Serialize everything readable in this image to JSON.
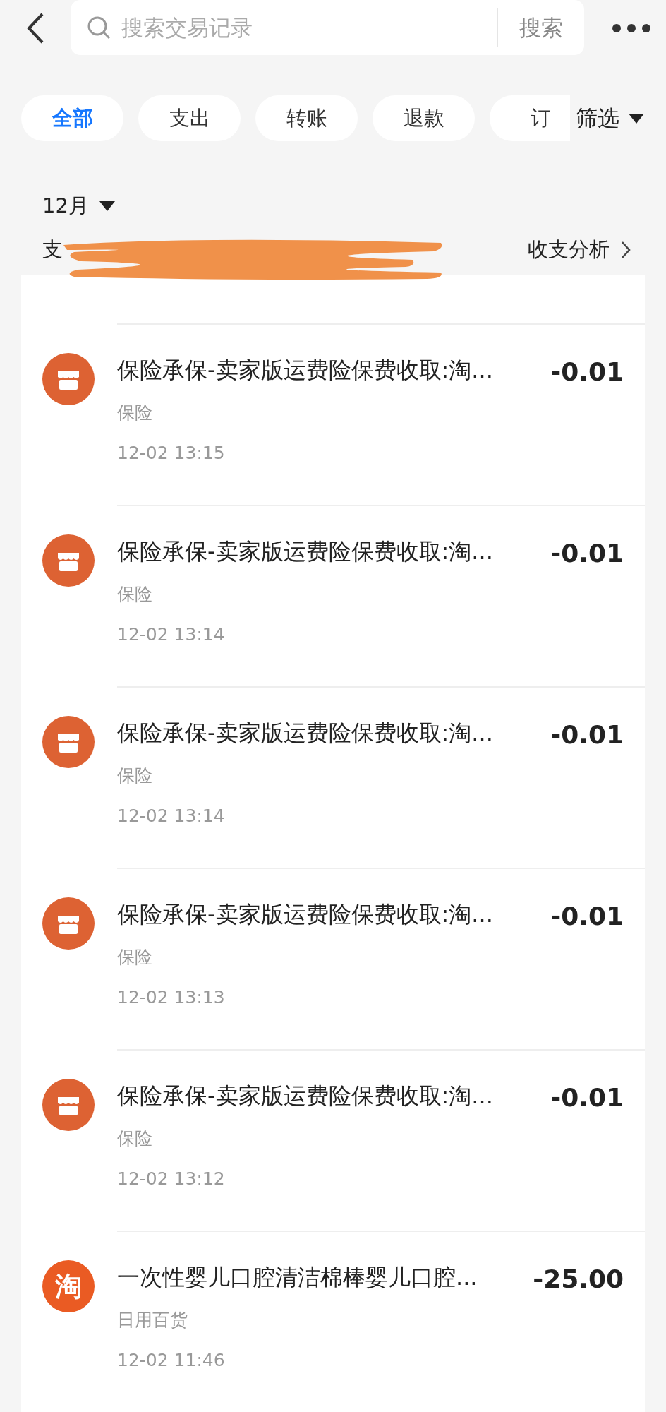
{
  "search": {
    "placeholder": "搜索交易记录",
    "button": "搜索"
  },
  "tabs": [
    {
      "label": "全部",
      "selected": true
    },
    {
      "label": "支出",
      "selected": false
    },
    {
      "label": "转账",
      "selected": false
    },
    {
      "label": "退款",
      "selected": false
    },
    {
      "label": "订",
      "selected": false
    }
  ],
  "filter": "筛选",
  "month": "12月",
  "summary": {
    "label": "支",
    "analysis": "收支分析"
  },
  "transactions": [
    {
      "kind": "store",
      "title": "保险承保-卖家版运费险保费收取:淘...",
      "amount": "-0.01",
      "category": "保险",
      "time": "12-02 13:15"
    },
    {
      "kind": "store",
      "title": "保险承保-卖家版运费险保费收取:淘...",
      "amount": "-0.01",
      "category": "保险",
      "time": "12-02 13:14"
    },
    {
      "kind": "store",
      "title": "保险承保-卖家版运费险保费收取:淘...",
      "amount": "-0.01",
      "category": "保险",
      "time": "12-02 13:14"
    },
    {
      "kind": "store",
      "title": "保险承保-卖家版运费险保费收取:淘...",
      "amount": "-0.01",
      "category": "保险",
      "time": "12-02 13:13"
    },
    {
      "kind": "store",
      "title": "保险承保-卖家版运费险保费收取:淘...",
      "amount": "-0.01",
      "category": "保险",
      "time": "12-02 13:12"
    },
    {
      "kind": "taobao",
      "icon_text": "淘",
      "title": "一次性婴儿口腔清洁棉棒婴儿口腔...",
      "amount": "-25.00",
      "category": "日用百货",
      "time": "12-02 11:46"
    }
  ]
}
